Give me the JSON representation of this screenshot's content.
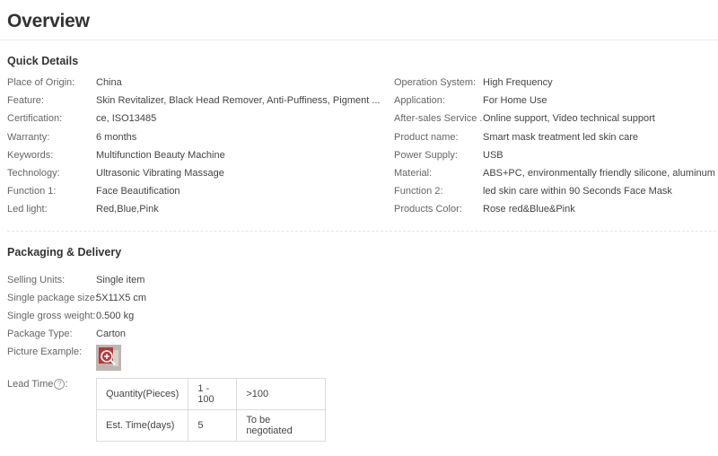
{
  "page": {
    "title": "Overview"
  },
  "quick_details": {
    "heading": "Quick Details",
    "left": [
      {
        "label": "Place of Origin:",
        "value": "China"
      },
      {
        "label": "Feature:",
        "value": "Skin Revitalizer, Black Head Remover, Anti-Puffiness, Pigment ..."
      },
      {
        "label": "Certification:",
        "value": "ce, ISO13485"
      },
      {
        "label": "Warranty:",
        "value": "6 months"
      },
      {
        "label": "Keywords:",
        "value": "Multifunction Beauty Machine"
      },
      {
        "label": "Technology:",
        "value": "Ultrasonic Vibrating Massage"
      },
      {
        "label": "Function 1:",
        "value": "Face Beautification"
      },
      {
        "label": "Led light:",
        "value": "Red,Blue,Pink"
      }
    ],
    "right": [
      {
        "label": "Operation System:",
        "value": "High Frequency"
      },
      {
        "label": "Application:",
        "value": "For Home Use"
      },
      {
        "label": "After-sales Service ...",
        "value": "Online support, Video technical support"
      },
      {
        "label": "Product name:",
        "value": "Smart mask treatment led skin care"
      },
      {
        "label": "Power Supply:",
        "value": "USB"
      },
      {
        "label": "Material:",
        "value": "ABS+PC, environmentally friendly silicone, aluminum"
      },
      {
        "label": "Function 2:",
        "value": "led skin care within 90 Seconds Face Mask"
      },
      {
        "label": "Products Color:",
        "value": "Rose red&Blue&Pink"
      }
    ]
  },
  "packaging": {
    "heading": "Packaging & Delivery",
    "rows": [
      {
        "label": "Selling Units:",
        "value": "Single item"
      },
      {
        "label": "Single package size:",
        "value": "5X11X5 cm"
      },
      {
        "label": "Single gross weight:",
        "value": "0.500 kg"
      },
      {
        "label": "Package Type:",
        "value": "Carton"
      }
    ],
    "picture_label": "Picture Example:",
    "lead_time_label": "Lead Time",
    "lead_time_suffix": ":",
    "help_icon_glyph": "?",
    "lead_table": [
      [
        "Quantity(Pieces)",
        "1 - 100",
        ">100"
      ],
      [
        "Est. Time(days)",
        "5",
        "To be negotiated"
      ]
    ]
  },
  "icons": {
    "help": "question-circle-icon",
    "zoom": "magnifier-zoom-icon"
  },
  "colors": {
    "text": "#333333",
    "thumb_accent": "#b23a3a"
  }
}
